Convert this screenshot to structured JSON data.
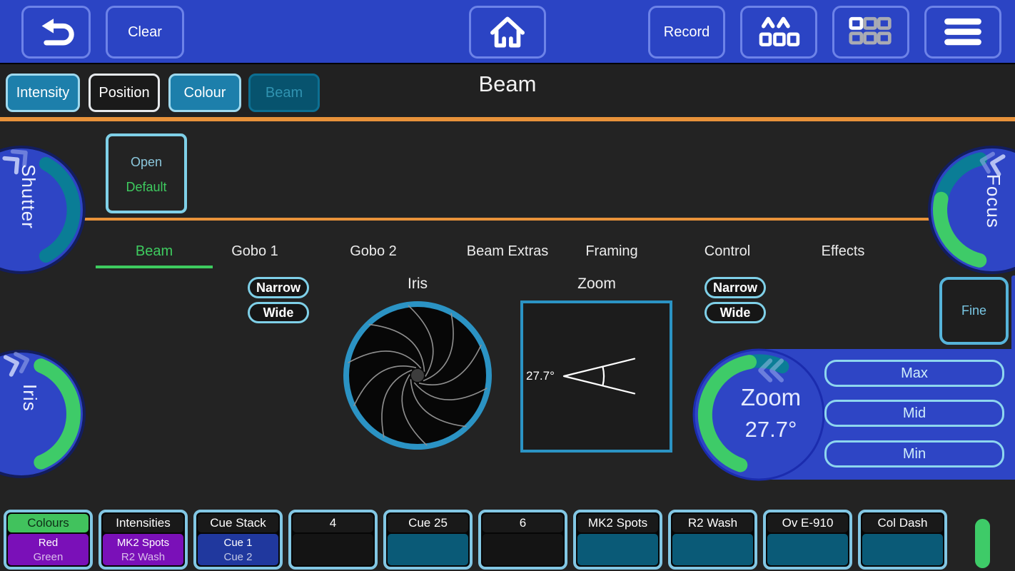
{
  "toolbar": {
    "clear_label": "Clear",
    "record_label": "Record"
  },
  "icons": {
    "back": "u-turn-left-arrow",
    "home": "house-outline",
    "fixtures": "moving-head-fixtures",
    "workspaces": "grid-of-windows",
    "menu": "hamburger-menu",
    "shutter_expand": "double-chevron-right",
    "iris_expand": "double-chevron-right",
    "focus_expand": "double-chevron-left",
    "zoom_collapse": "double-chevron-left"
  },
  "page_title": "Beam",
  "palette_tabs": [
    {
      "label": "Intensity",
      "style": "teal"
    },
    {
      "label": "Position",
      "style": "plain"
    },
    {
      "label": "Colour",
      "style": "teal"
    },
    {
      "label": "Beam",
      "style": "dimmed",
      "selected": true
    }
  ],
  "preset_button": {
    "line1": "Open",
    "line2": "Default"
  },
  "sub_tabs": [
    {
      "label": "Beam",
      "active": true
    },
    {
      "label": "Gobo 1"
    },
    {
      "label": "Gobo 2"
    },
    {
      "label": "Beam Extras"
    },
    {
      "label": "Framing"
    },
    {
      "label": "Control"
    },
    {
      "label": "Effects"
    }
  ],
  "encoders": {
    "shutter": {
      "label": "Shutter"
    },
    "iris": {
      "label": "Iris"
    },
    "focus": {
      "label": "Focus"
    }
  },
  "iris_section": {
    "label": "Iris",
    "narrow": "Narrow",
    "wide": "Wide"
  },
  "zoom_section": {
    "label": "Zoom",
    "angle_text": "27.7°",
    "narrow": "Narrow",
    "wide": "Wide"
  },
  "zoom_encoder": {
    "label": "Zoom",
    "value": "27.7°",
    "presets": [
      "Max",
      "Mid",
      "Min"
    ]
  },
  "fine_label": "Fine",
  "playbacks": [
    {
      "title": "Colours",
      "header": "green",
      "body": "purple",
      "lines": [
        "Red",
        "Green"
      ]
    },
    {
      "title": "Intensities",
      "header": "dark",
      "body": "purple",
      "lines": [
        "MK2 Spots",
        "R2 Wash"
      ]
    },
    {
      "title": "Cue Stack",
      "header": "dark",
      "body": "blue",
      "lines": [
        "Cue 1",
        "Cue 2"
      ]
    },
    {
      "title": "4",
      "header": "dark",
      "body": "black",
      "lines": []
    },
    {
      "title": "Cue 25",
      "header": "dark",
      "body": "teal",
      "lines": []
    },
    {
      "title": "6",
      "header": "dark",
      "body": "black",
      "lines": []
    },
    {
      "title": "MK2 Spots",
      "header": "dark",
      "body": "teal",
      "lines": []
    },
    {
      "title": "R2 Wash",
      "header": "dark",
      "body": "teal",
      "lines": []
    },
    {
      "title": "Ov E-910",
      "header": "dark",
      "body": "teal",
      "lines": []
    },
    {
      "title": "Col Dash",
      "header": "dark",
      "body": "teal",
      "lines": []
    }
  ],
  "status": {
    "grand_master_indicator": "green"
  },
  "colors": {
    "toolbar_blue": "#2b44c4",
    "accent_orange": "#e8923a",
    "teal_tab": "#1d7fab",
    "light_blue_border": "#7fd0e8",
    "active_green": "#3ecb5f",
    "encoder_blue": "#2e45c5",
    "arc_teal": "#0a7d96",
    "arc_green": "#3ecb68",
    "iris_ring_blue": "#2b93c4",
    "playback_purple": "#7a10b8",
    "playback_teal": "#0a5a77",
    "playback_blue": "#20389e"
  }
}
